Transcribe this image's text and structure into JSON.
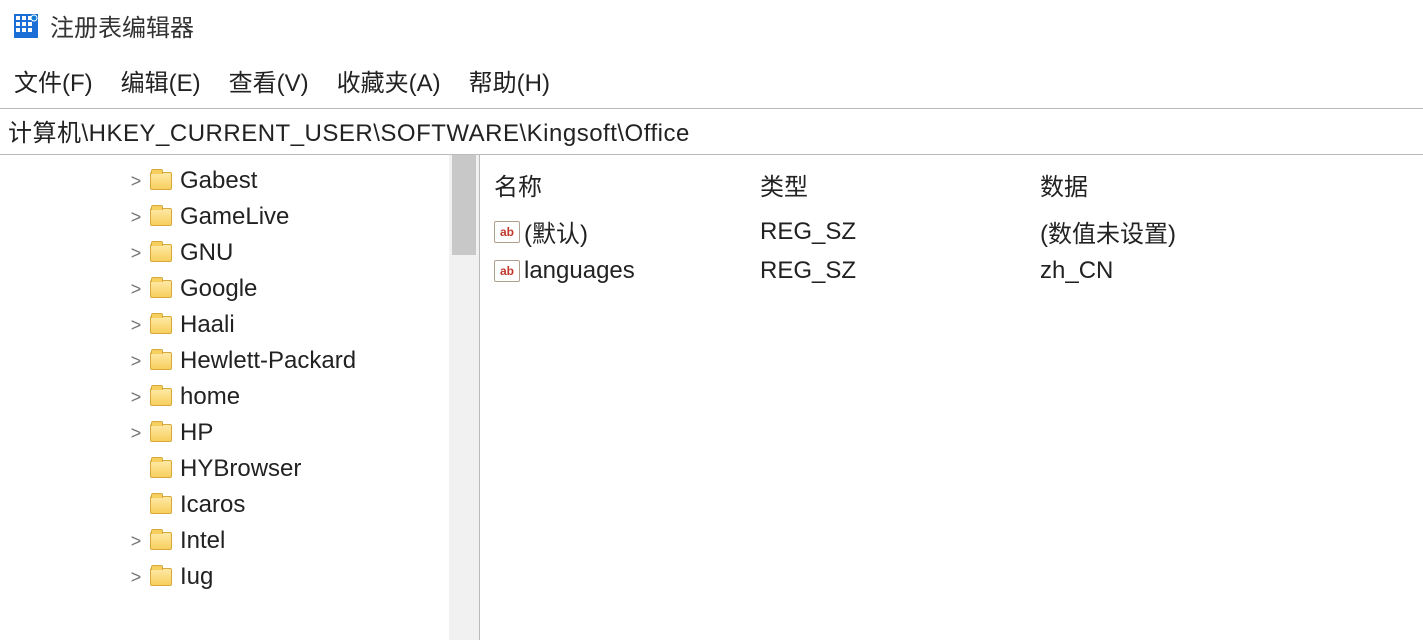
{
  "window": {
    "title": "注册表编辑器"
  },
  "menu": {
    "file": "文件(F)",
    "edit": "编辑(E)",
    "view": "查看(V)",
    "favorites": "收藏夹(A)",
    "help": "帮助(H)"
  },
  "path": "计算机\\HKEY_CURRENT_USER\\SOFTWARE\\Kingsoft\\Office",
  "tree": {
    "items": [
      {
        "label": "Gabest",
        "expandable": true
      },
      {
        "label": "GameLive",
        "expandable": true
      },
      {
        "label": "GNU",
        "expandable": true
      },
      {
        "label": "Google",
        "expandable": true
      },
      {
        "label": "Haali",
        "expandable": true
      },
      {
        "label": "Hewlett-Packard",
        "expandable": true
      },
      {
        "label": "home",
        "expandable": true
      },
      {
        "label": "HP",
        "expandable": true
      },
      {
        "label": "HYBrowser",
        "expandable": false
      },
      {
        "label": "Icaros",
        "expandable": false
      },
      {
        "label": "Intel",
        "expandable": true
      },
      {
        "label": "Iug",
        "expandable": true
      }
    ]
  },
  "list": {
    "headers": {
      "name": "名称",
      "type": "类型",
      "data": "数据"
    },
    "rows": [
      {
        "icon": "ab",
        "name": "(默认)",
        "type": "REG_SZ",
        "data": "(数值未设置)"
      },
      {
        "icon": "ab",
        "name": "languages",
        "type": "REG_SZ",
        "data": "zh_CN"
      }
    ]
  }
}
